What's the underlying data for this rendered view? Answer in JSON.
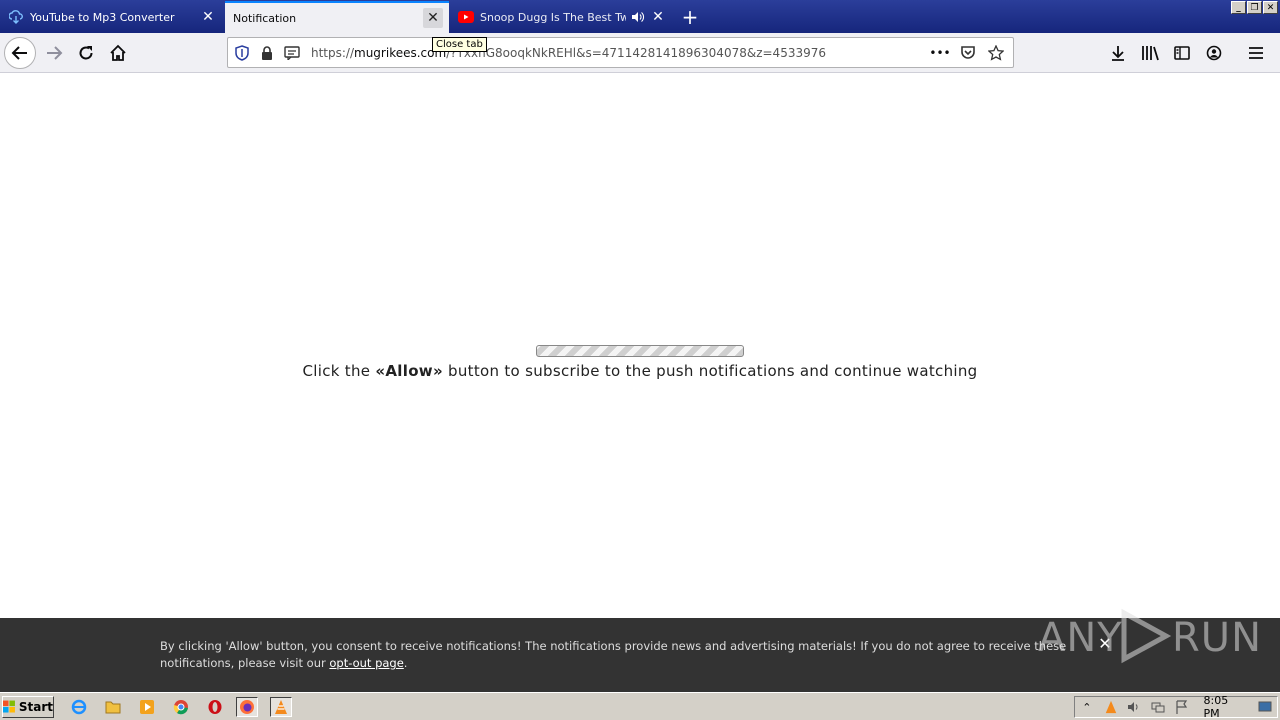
{
  "tabs": [
    {
      "title": "YouTube to Mp3 Converter",
      "icon": "download-cloud-icon"
    },
    {
      "title": "Notification",
      "icon": ""
    },
    {
      "title": "Snoop Dugg Is The Best Twitch",
      "icon": "youtube-icon"
    }
  ],
  "tooltip": "Close tab",
  "url": {
    "prefix": "https://",
    "domain": "mugrikees.com",
    "path": "/?TxxnG8ooqkNkREHl&s=4711428141896304078&z=4533976"
  },
  "page": {
    "message_pre": "Click the ",
    "message_bold": "«Allow»",
    "message_post": " button to subscribe to the push notifications and continue watching",
    "progress_state": "indeterminate"
  },
  "consent": {
    "text": "By clicking 'Allow' button, you consent to receive notifications! The notifications provide news and advertising materials! If you do not agree to receive these notifications, please visit our ",
    "link": "opt-out page",
    "end": "."
  },
  "watermark": "ANY▷RUN",
  "taskbar": {
    "start": "Start",
    "clock": "8:05 PM"
  },
  "colors": {
    "tab_active_border": "#0a84ff",
    "consent_bg": "#333333",
    "tabstrip": "#16267c"
  }
}
